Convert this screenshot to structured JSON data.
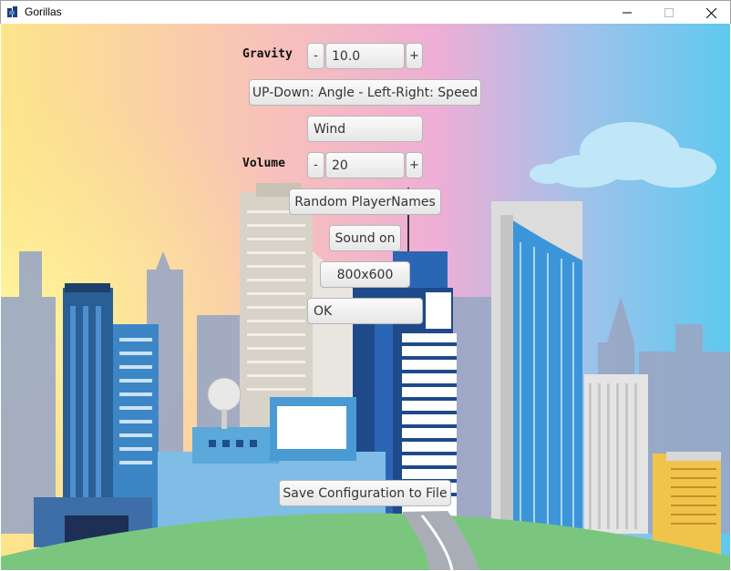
{
  "window": {
    "title": "Gorillas",
    "min_glyph": "—",
    "max_glyph": "☐",
    "close_glyph": "✕"
  },
  "settings": {
    "gravity_label": "Gravity",
    "gravity_value": "10.0",
    "volume_label": "Volume",
    "volume_value": "20",
    "decrement": "-",
    "increment": "+",
    "controls_button": "UP-Down: Angle - Left-Right: Speed",
    "wind_button": "Wind",
    "random_names_button": "Random PlayerNames",
    "sound_button": "Sound on",
    "resolution_button": "800x600",
    "ok_button": "OK",
    "save_button": "Save Configuration to File"
  },
  "colors": {
    "sky_left": "#fde58a",
    "sky_mid": "#f6b6c8",
    "sky_right": "#5ec9ef",
    "grass": "#7bc67e",
    "road": "#a9aeb6"
  }
}
